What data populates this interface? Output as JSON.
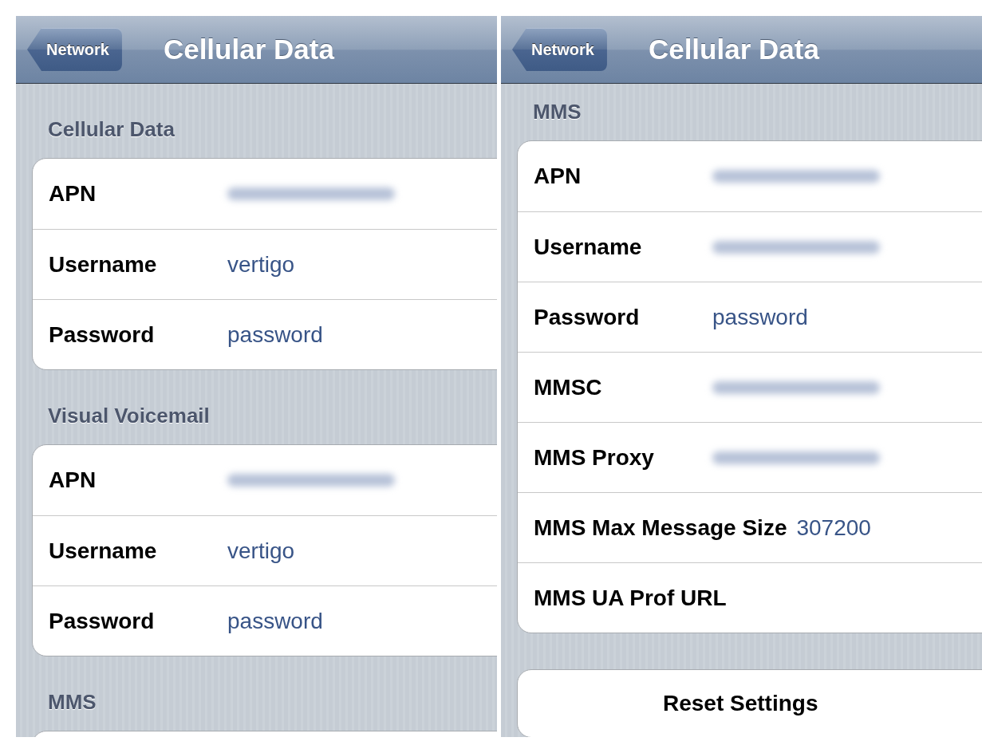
{
  "panels": [
    {
      "nav": {
        "back": "Network",
        "title": "Cellular Data"
      },
      "sections": [
        {
          "kind": "group",
          "header": "Cellular Data",
          "rows": [
            {
              "label": "APN",
              "kind": "blurred"
            },
            {
              "label": "Username",
              "kind": "text",
              "value": "vertigo"
            },
            {
              "label": "Password",
              "kind": "text",
              "value": "password"
            }
          ]
        },
        {
          "kind": "group",
          "header": "Visual Voicemail",
          "rows": [
            {
              "label": "APN",
              "kind": "blurred"
            },
            {
              "label": "Username",
              "kind": "text",
              "value": "vertigo"
            },
            {
              "label": "Password",
              "kind": "text",
              "value": "password"
            }
          ]
        },
        {
          "kind": "group",
          "header": "MMS"
        }
      ]
    },
    {
      "nav": {
        "back": "Network",
        "title": "Cellular Data"
      },
      "sections": [
        {
          "kind": "group",
          "header": "MMS",
          "rows": [
            {
              "label": "APN",
              "kind": "blurred"
            },
            {
              "label": "Username",
              "kind": "blurred"
            },
            {
              "label": "Password",
              "kind": "text",
              "value": "password"
            },
            {
              "label": "MMSC",
              "kind": "blurred"
            },
            {
              "label": "MMS Proxy",
              "kind": "blurred"
            },
            {
              "label": "MMS Max Message Size",
              "kind": "text",
              "value": "307200"
            },
            {
              "label": "MMS UA Prof URL",
              "kind": "empty"
            }
          ]
        },
        {
          "kind": "button",
          "label": "Reset Settings"
        }
      ]
    }
  ]
}
